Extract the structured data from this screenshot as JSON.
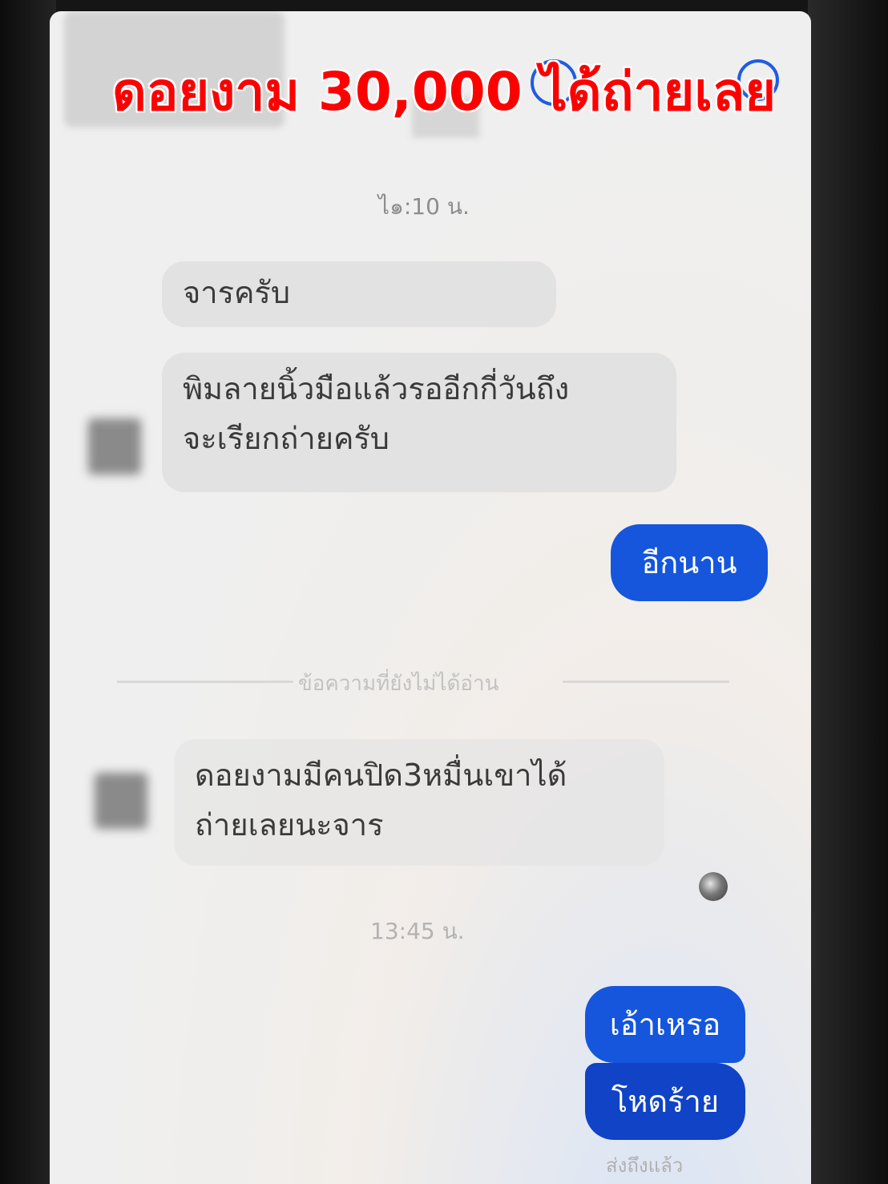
{
  "overlay": {
    "title": "ดอยงาม 30,000 ได้ถ่ายเลย",
    "color": "#ff0000"
  },
  "chat": {
    "messages": [
      {
        "type": "timestamp",
        "text": "ไ๑:10 น."
      },
      {
        "type": "incoming",
        "text": "จารครับ"
      },
      {
        "type": "incoming",
        "line1": "พิมลายนิ้วมือแล้วรออีกกี่วันถึง",
        "line2": "จะเรียกถ่ายครับ"
      },
      {
        "type": "outgoing",
        "text": "อีกนาน"
      },
      {
        "type": "divider",
        "text": "ข้อความที่ยังไม่ได้อ่าน"
      },
      {
        "type": "incoming",
        "line1": "ดอยงามมีคนปิด3หมื่นเขาได้",
        "line2": "ถ่ายเลยนะจาร"
      },
      {
        "type": "timestamp",
        "text": "13:45 น."
      },
      {
        "type": "outgoing",
        "text": "เอ้าเหรอ"
      },
      {
        "type": "outgoing",
        "text": "โหดร้าย"
      }
    ],
    "status": "ส่งถึงแล้ว",
    "colors": {
      "outgoing_bubble": "#1556dd",
      "incoming_bubble": "#e2e2e2"
    }
  }
}
